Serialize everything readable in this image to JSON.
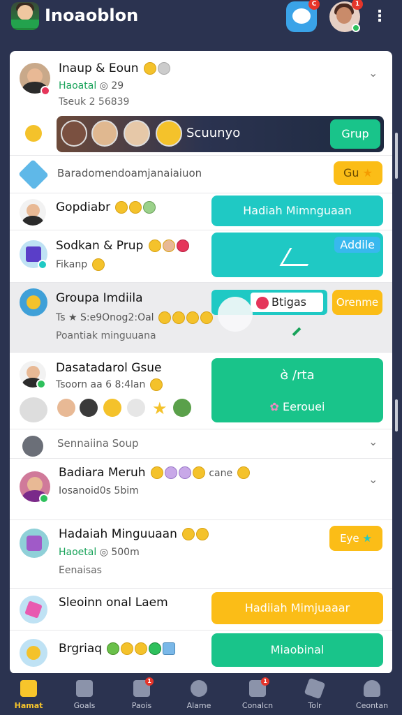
{
  "app": {
    "title": "Inoaoblon"
  },
  "header": {
    "messages_badge": "C",
    "profile_badge": "1",
    "more_label": "⋮"
  },
  "rows": {
    "group1": {
      "title": "Inaup & Eoun",
      "status": "Haoatal",
      "status_count": "◎ 29",
      "meta": "Tseuk 2 56839"
    },
    "banner": {
      "label": "Scuunyo",
      "button": "Grup"
    },
    "recommend": {
      "text": "Baradomendoamjanaiaiuon",
      "button": "Gu"
    },
    "gap": {
      "title": "Gopdiabr",
      "button": "Hadiah Mimnguaan"
    },
    "sodkan": {
      "title": "Sodkan & Prup",
      "sub": "Fikanp",
      "button": "Addile"
    },
    "groups": {
      "title": "Groupa Imdiila",
      "sub": "Ts ★ S:e9Onog2:Oal",
      "meta": "Poantiak minguuana",
      "button_red": "Btigas",
      "button_orange": "Orenme"
    },
    "dasa": {
      "title": "Dasatadarol Gsue",
      "sub": "Tsoorn aa 6 8:4lan",
      "button_top": "ɞ̀ /rta",
      "button_bottom": "Eerouei"
    },
    "sennaiina": {
      "title": "Sennaiina Soup"
    },
    "badiara": {
      "title": "Badiara Meruh",
      "extra": "cane",
      "sub": "Iosanoid0s 5bim"
    },
    "hadiah": {
      "title": "Hadaiah Minguuaan",
      "status": "Haoetal",
      "status_count": "◎ 500m",
      "meta": "Eenaisas",
      "button": "Eye"
    },
    "sleoinn": {
      "title": "Sleoinn onal Laem",
      "button": "Hadiiah Mimjuaaar"
    },
    "brgriaq": {
      "title": "Brgriaq",
      "button": "Miaobinal"
    }
  },
  "nav": [
    {
      "label": "Hamat",
      "icon": "home-icon",
      "active": true
    },
    {
      "label": "Goals",
      "icon": "flag-icon"
    },
    {
      "label": "Paois",
      "icon": "chat-icon",
      "badge": "1"
    },
    {
      "label": "Alame",
      "icon": "alarm-icon"
    },
    {
      "label": "Conalcn",
      "icon": "calendar-icon",
      "badge": "1"
    },
    {
      "label": "Tolr",
      "icon": "send-icon"
    },
    {
      "label": "Ceontan",
      "icon": "profile-icon"
    }
  ],
  "colors": {
    "topbar": "#2b3350",
    "teal": "#1fc9c4",
    "green": "#19c48a",
    "yellow": "#fbbd17",
    "active_nav": "#f7c52b"
  }
}
